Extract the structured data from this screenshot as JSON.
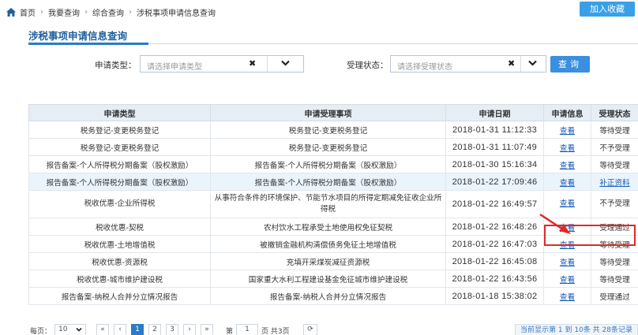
{
  "breadcrumb": [
    "首页",
    "我要查询",
    "综合查询",
    "涉税事项申请信息查询"
  ],
  "fav_button": "加入收藏",
  "page_title": "涉税事项申请信息查询",
  "filters": {
    "type_label": "申请类型：",
    "type_placeholder": "请选择申请类型",
    "status_label": "受理状态：",
    "status_placeholder": "请选择受理状态",
    "clear_glyph": "✖",
    "query_button": "查询"
  },
  "table": {
    "headers": [
      "申请类型",
      "申请受理事项",
      "申请日期",
      "申请信息",
      "受理状态"
    ],
    "rows": [
      {
        "type": "税务登记-变更税务登记",
        "item": "税务登记-变更税务登记",
        "date": "2018-01-31 11:12:33",
        "info": "查看",
        "status": "等待受理"
      },
      {
        "type": "税务登记-变更税务登记",
        "item": "税务登记-变更税务登记",
        "date": "2018-01-31 11:07:49",
        "info": "查看",
        "status": "不予受理"
      },
      {
        "type": "报告备案-个人所得税分期备案（股权激励）",
        "item": "报告备案-个人所得税分期备案（股权激励）",
        "date": "2018-01-30 15:16:34",
        "info": "查看",
        "status": "等待受理"
      },
      {
        "type": "报告备案-个人所得税分期备案（股权激励）",
        "item": "报告备案-个人所得税分期备案（股权激励）",
        "date": "2018-01-22 17:09:46",
        "info": "查看",
        "status": "补正资料"
      },
      {
        "type": "税收优惠-企业所得税",
        "item": "从事符合条件的环境保护、节能节水项目的所得定期减免征收企业所得税",
        "date": "2018-01-22 16:49:57",
        "info": "查看",
        "status": "不予受理"
      },
      {
        "type": "税收优惠-契税",
        "item": "农村饮水工程承受土地使用权免征契税",
        "date": "2018-01-22 16:48:26",
        "info": "查看",
        "status": "受理通过"
      },
      {
        "type": "税收优惠-土地增值税",
        "item": "被撤销金融机构清偿债务免征土地增值税",
        "date": "2018-01-22 16:47:03",
        "info": "查看",
        "status": "等待受理"
      },
      {
        "type": "税收优惠-资源税",
        "item": "充填开采煤炭减征资源税",
        "date": "2018-01-22 16:45:08",
        "info": "查看",
        "status": "等待受理"
      },
      {
        "type": "税收优惠-城市维护建设税",
        "item": "国家重大水利工程建设基金免征城市维护建设税",
        "date": "2018-01-22 16:43:56",
        "info": "查看",
        "status": "等待受理"
      },
      {
        "type": "报告备案-纳税人合并分立情况报告",
        "item": "报告备案-纳税人合并分立情况报告",
        "date": "2018-01-18 15:38:02",
        "info": "查看",
        "status": "受理通过"
      }
    ]
  },
  "pager": {
    "per_page_label": "每页：",
    "per_page_value": "10",
    "first": "«",
    "prev": "‹",
    "pages": [
      "1",
      "2",
      "3"
    ],
    "next": "›",
    "last": "»",
    "goto_prefix": "第",
    "goto_value": "1",
    "goto_suffix": "页 共3页",
    "refresh_glyph": "⟳",
    "info": "当前显示第 1 到 10条 共 28条记录"
  },
  "colors": {
    "accent": "#2a7bc8",
    "link": "#1a59b8",
    "highlight_box": "#e02828"
  }
}
